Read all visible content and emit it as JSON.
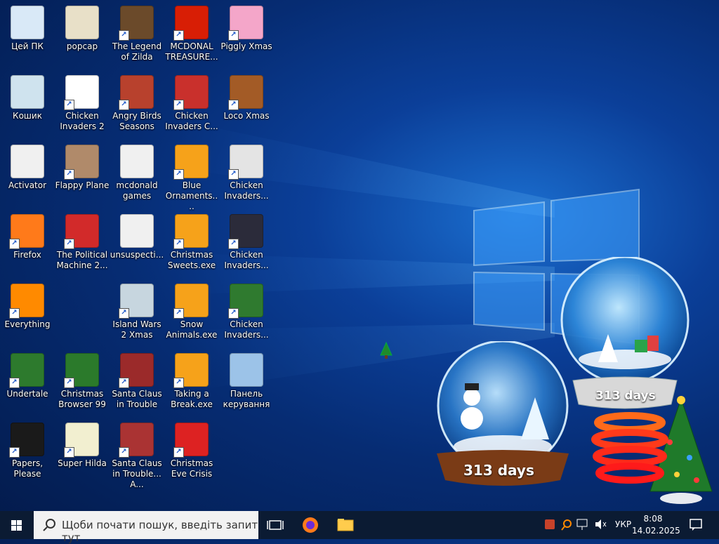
{
  "desktop": {
    "icons": [
      {
        "label": "Цей ПК",
        "shortcut": false,
        "icon": "computer-icon",
        "color": "#d9e9f7"
      },
      {
        "label": "popcap",
        "shortcut": false,
        "icon": "folder-icon",
        "color": "#e8e0c8"
      },
      {
        "label": "The Legend of Zilda",
        "shortcut": true,
        "icon": "game-icon",
        "color": "#6b4a2a"
      },
      {
        "label": "MCDONAL TREASURE...",
        "shortcut": true,
        "icon": "mcdonalds-icon",
        "color": "#d81e05"
      },
      {
        "label": "Piggly Xmas",
        "shortcut": true,
        "icon": "pig-icon",
        "color": "#f4a6c9"
      },
      {
        "label": "Кошик",
        "shortcut": false,
        "icon": "recycle-bin-icon",
        "color": "#cfe3ee"
      },
      {
        "label": "Chicken Invaders 2",
        "shortcut": true,
        "icon": "chicken-icon",
        "color": "#ffffff"
      },
      {
        "label": "Angry Birds Seasons",
        "shortcut": true,
        "icon": "angry-bird-icon",
        "color": "#b8412d"
      },
      {
        "label": "Chicken Invaders C...",
        "shortcut": true,
        "icon": "snowman-icon",
        "color": "#c9302c"
      },
      {
        "label": "Loco Xmas",
        "shortcut": true,
        "icon": "bear-icon",
        "color": "#a35b26"
      },
      {
        "label": "Activator",
        "shortcut": false,
        "icon": "folder-icon",
        "color": "#f0f0f0"
      },
      {
        "label": "Flappy Plane",
        "shortcut": true,
        "icon": "plane-icon",
        "color": "#b08a6a"
      },
      {
        "label": "mcdonald games",
        "shortcut": false,
        "icon": "folder-icon",
        "color": "#f0f0f0"
      },
      {
        "label": "Blue Ornaments....",
        "shortcut": true,
        "icon": "installer-icon",
        "color": "#f6a21a"
      },
      {
        "label": "Chicken Invaders...",
        "shortcut": true,
        "icon": "chicken-icon",
        "color": "#e4e4e4"
      },
      {
        "label": "Firefox",
        "shortcut": true,
        "icon": "firefox-icon",
        "color": "#ff7a1a"
      },
      {
        "label": "The Political Machine 2...",
        "shortcut": true,
        "icon": "badge-icon",
        "color": "#d22a2a"
      },
      {
        "label": "unsuspecti...",
        "shortcut": false,
        "icon": "folder-icon",
        "color": "#f0f0f0"
      },
      {
        "label": "Christmas Sweets.exe",
        "shortcut": true,
        "icon": "installer-icon",
        "color": "#f6a21a"
      },
      {
        "label": "Chicken Invaders...",
        "shortcut": true,
        "icon": "chicken-icon",
        "color": "#2b2b3a"
      },
      {
        "label": "Everything",
        "shortcut": true,
        "icon": "search-icon",
        "color": "#ff8a00"
      },
      {
        "label": "Island Wars 2 Xmas",
        "shortcut": true,
        "icon": "island-icon",
        "color": "#c7d6df"
      },
      {
        "label": "Snow Animals.exe",
        "shortcut": true,
        "icon": "installer-icon",
        "color": "#f6a21a"
      },
      {
        "label": "Chicken Invaders...",
        "shortcut": true,
        "icon": "chicken-icon",
        "color": "#2f7a2f"
      },
      {
        "label": "Undertale",
        "shortcut": true,
        "icon": "undertale-icon",
        "color": "#2d7a2d"
      },
      {
        "label": "Christmas Browser 99",
        "shortcut": true,
        "icon": "tree-icon",
        "color": "#2b7a2b"
      },
      {
        "label": "Santa Claus in Trouble",
        "shortcut": true,
        "icon": "santa-icon",
        "color": "#9b2a2a"
      },
      {
        "label": "Taking a Break.exe",
        "shortcut": true,
        "icon": "installer-icon",
        "color": "#f6a21a"
      },
      {
        "label": "Панель керування",
        "shortcut": false,
        "icon": "control-panel-icon",
        "color": "#9cc3e8"
      },
      {
        "label": "Papers, Please",
        "shortcut": true,
        "icon": "papers-icon",
        "color": "#1a1a1a"
      },
      {
        "label": "Super Hilda",
        "shortcut": true,
        "icon": "pixel-icon",
        "color": "#f2efd0"
      },
      {
        "label": "Santa Claus in Trouble... A...",
        "shortcut": true,
        "icon": "santa-icon",
        "color": "#a33"
      },
      {
        "label": "Christmas Eve Crisis",
        "shortcut": true,
        "icon": "santa-icon",
        "color": "#d22"
      }
    ]
  },
  "widgets": {
    "globe_left_text": "313 days",
    "globe_right_text": "313 days"
  },
  "taskbar": {
    "search_placeholder": "Щоби почати пошук, введіть запит тут",
    "language": "УКР",
    "time": "8:08",
    "date": "14.02.2025"
  }
}
